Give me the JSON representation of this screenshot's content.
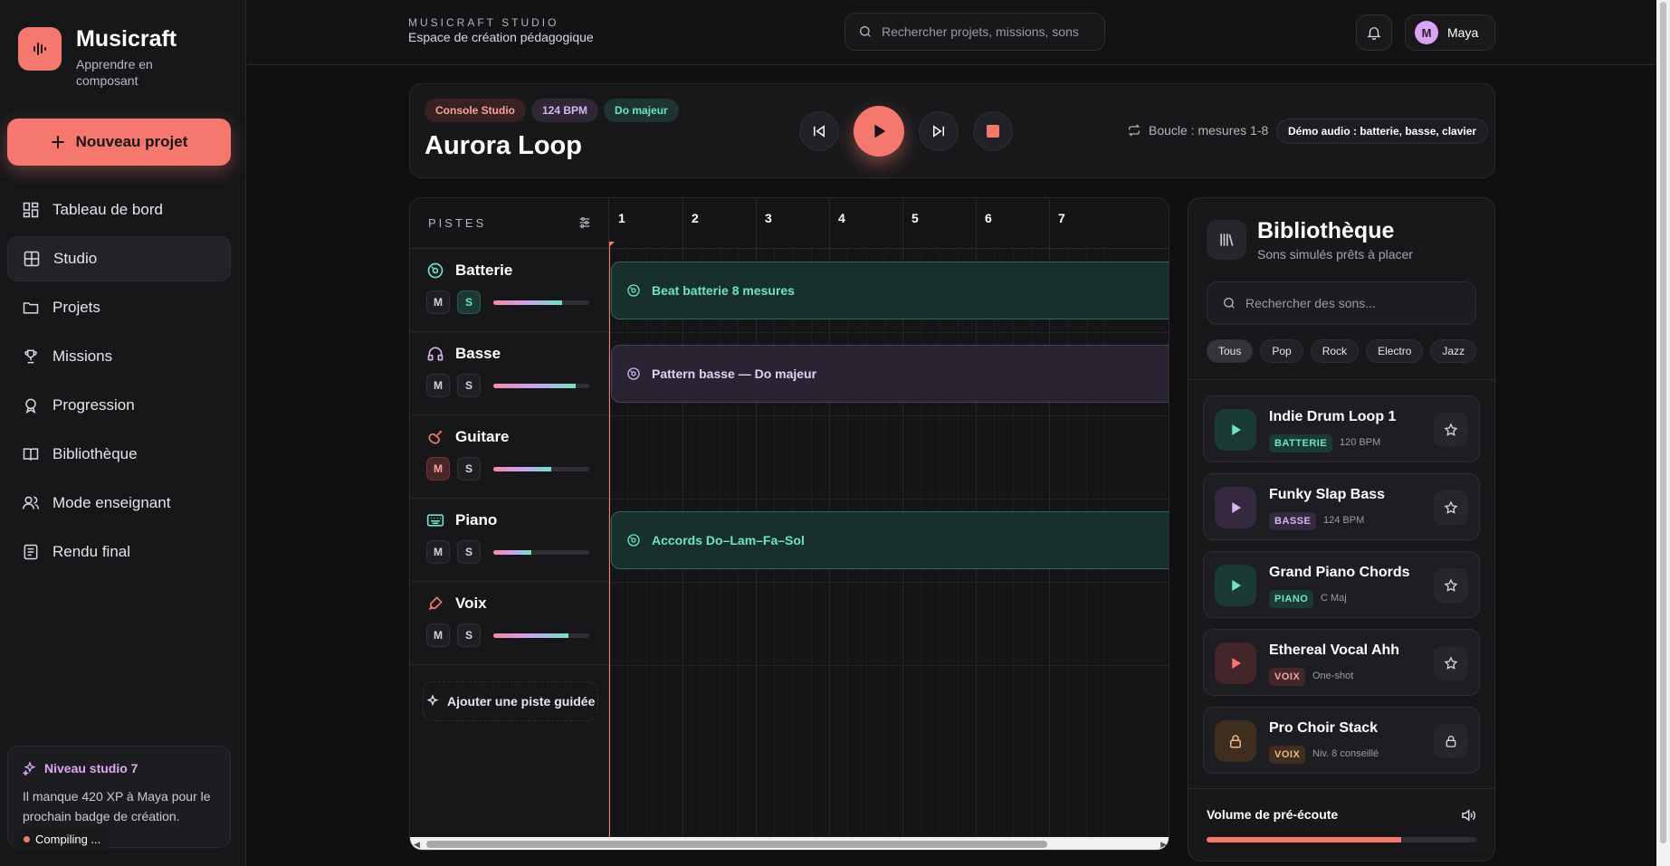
{
  "brand": {
    "name": "Musicraft",
    "tagline": "Apprendre en composant"
  },
  "sidebar": {
    "new_project": "Nouveau projet",
    "items": [
      {
        "label": "Tableau de bord",
        "icon": "dashboard-icon"
      },
      {
        "label": "Studio",
        "icon": "grid-icon",
        "active": true
      },
      {
        "label": "Projets",
        "icon": "folder-icon"
      },
      {
        "label": "Missions",
        "icon": "trophy-icon"
      },
      {
        "label": "Progression",
        "icon": "badge-icon"
      },
      {
        "label": "Bibliothèque",
        "icon": "book-icon"
      },
      {
        "label": "Mode enseignant",
        "icon": "users-icon"
      },
      {
        "label": "Rendu final",
        "icon": "document-icon"
      }
    ],
    "level": {
      "title": "Niveau studio 7",
      "text": "Il manque 420 XP à Maya pour le prochain badge de création."
    },
    "compiling": "Compiling ..."
  },
  "topbar": {
    "eyebrow": "MUSICRAFT STUDIO",
    "subtitle": "Espace de création pédagogique",
    "search_placeholder": "Rechercher projets, missions, sons",
    "user_initial": "M",
    "user_name": "Maya"
  },
  "transport": {
    "chips": [
      "Console Studio",
      "124 BPM",
      "Do majeur"
    ],
    "title": "Aurora Loop",
    "loop": "Boucle : mesures 1-8",
    "demo": "Démo audio : batterie, basse, clavier"
  },
  "tracks": {
    "header": "PISTES",
    "items": [
      {
        "name": "Batterie",
        "icon": "drum-icon",
        "color": "#6fe3c6",
        "volume": 0.72,
        "mute": false,
        "solo": true
      },
      {
        "name": "Basse",
        "icon": "headphones-icon",
        "color": "#d7b6f0",
        "volume": 0.86,
        "mute": false,
        "solo": false
      },
      {
        "name": "Guitare",
        "icon": "guitar-icon",
        "color": "#f4786e",
        "volume": 0.6,
        "mute": true,
        "solo": false
      },
      {
        "name": "Piano",
        "icon": "keyboard-icon",
        "color": "#6fe3c6",
        "volume": 0.4,
        "mute": false,
        "solo": false
      },
      {
        "name": "Voix",
        "icon": "microphone-icon",
        "color": "#f4786e",
        "volume": 0.78,
        "mute": false,
        "solo": false
      }
    ],
    "mute_label": "M",
    "solo_label": "S",
    "add_track": "Ajouter une piste guidée"
  },
  "timeline": {
    "bars": [
      "1",
      "2",
      "3",
      "4",
      "5",
      "6",
      "7"
    ],
    "clips": [
      {
        "label": "Beat batterie 8 mesures",
        "track": 0,
        "style": "green"
      },
      {
        "label": "Pattern basse — Do majeur",
        "track": 1,
        "style": "purple"
      },
      {
        "label": "Accords Do–Lam–Fa–Sol",
        "track": 3,
        "style": "green"
      }
    ]
  },
  "library": {
    "title": "Bibliothèque",
    "subtitle": "Sons simulés prêts à placer",
    "search_placeholder": "Rechercher des sons...",
    "filters": [
      "Tous",
      "Pop",
      "Rock",
      "Electro",
      "Jazz"
    ],
    "sounds": [
      {
        "name": "Indie Drum Loop 1",
        "tag": "BATTERIE",
        "meta": "120 BPM",
        "style": "green",
        "locked": false
      },
      {
        "name": "Funky Slap Bass",
        "tag": "BASSE",
        "meta": "124 BPM",
        "style": "purple",
        "locked": false
      },
      {
        "name": "Grand Piano Chords",
        "tag": "PIANO",
        "meta": "C Maj",
        "style": "green",
        "locked": false
      },
      {
        "name": "Ethereal Vocal Ahh",
        "tag": "VOIX",
        "meta": "One-shot",
        "style": "red",
        "locked": false
      },
      {
        "name": "Pro Choir Stack",
        "tag": "VOIX",
        "meta": "Niv. 8 conseillé",
        "style": "orange",
        "locked": true
      }
    ],
    "preview_label": "Volume de pré-écoute",
    "preview_volume": 0.72
  },
  "colors": {
    "accent": "#f4786e",
    "green": "#6fe3c6",
    "purple": "#d7b6f0"
  }
}
